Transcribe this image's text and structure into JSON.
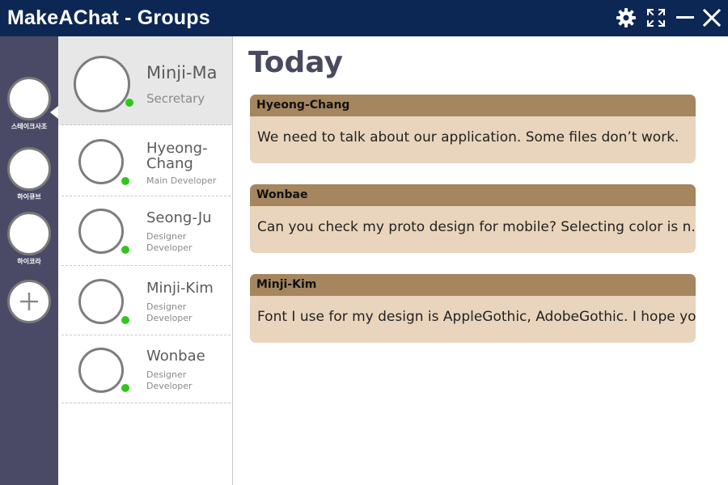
{
  "window": {
    "title": "MakeAChat - Groups",
    "controls": [
      {
        "name": "settings",
        "icon": "gear-icon"
      },
      {
        "name": "fullscreen",
        "icon": "fullscreen-icon"
      },
      {
        "name": "minimize",
        "icon": "minimize-icon"
      },
      {
        "name": "close",
        "icon": "close-icon"
      }
    ]
  },
  "groups": [
    {
      "label": "스테이크사조",
      "selected": true
    },
    {
      "label": "하이큐브",
      "selected": false
    },
    {
      "label": "하이코라",
      "selected": false
    }
  ],
  "add_group": {
    "icon": "plus-icon"
  },
  "contacts": [
    {
      "name": "Minji-Ma",
      "role": "Secretary",
      "online": true,
      "active": true
    },
    {
      "name": "Hyeong-Chang",
      "role": "Main Developer",
      "online": true,
      "active": false
    },
    {
      "name": "Seong-Ju",
      "role": "Designer Developer",
      "online": true,
      "active": false
    },
    {
      "name": "Minji-Kim",
      "role": "Designer Developer",
      "online": true,
      "active": false
    },
    {
      "name": "Wonbae",
      "role": "Designer Developer",
      "online": true,
      "active": false
    }
  ],
  "main": {
    "heading": "Today",
    "messages": [
      {
        "sender": "Hyeong-Chang",
        "text": "We need to talk about our application. Some files don’t work."
      },
      {
        "sender": "Wonbae",
        "text": "Can you check my proto design for mobile? Selecting color is n.."
      },
      {
        "sender": "Minji-Kim",
        "text": "Font I use for my design is AppleGothic, AdobeGothic. I hope yo.."
      }
    ]
  },
  "colors": {
    "titlebar": "#0d2754",
    "rail": "#4a4a66",
    "online_status": "#2fc71c",
    "message_header": "#a5865f",
    "message_body": "#e9d5bd",
    "heading": "#4a4a5f"
  }
}
